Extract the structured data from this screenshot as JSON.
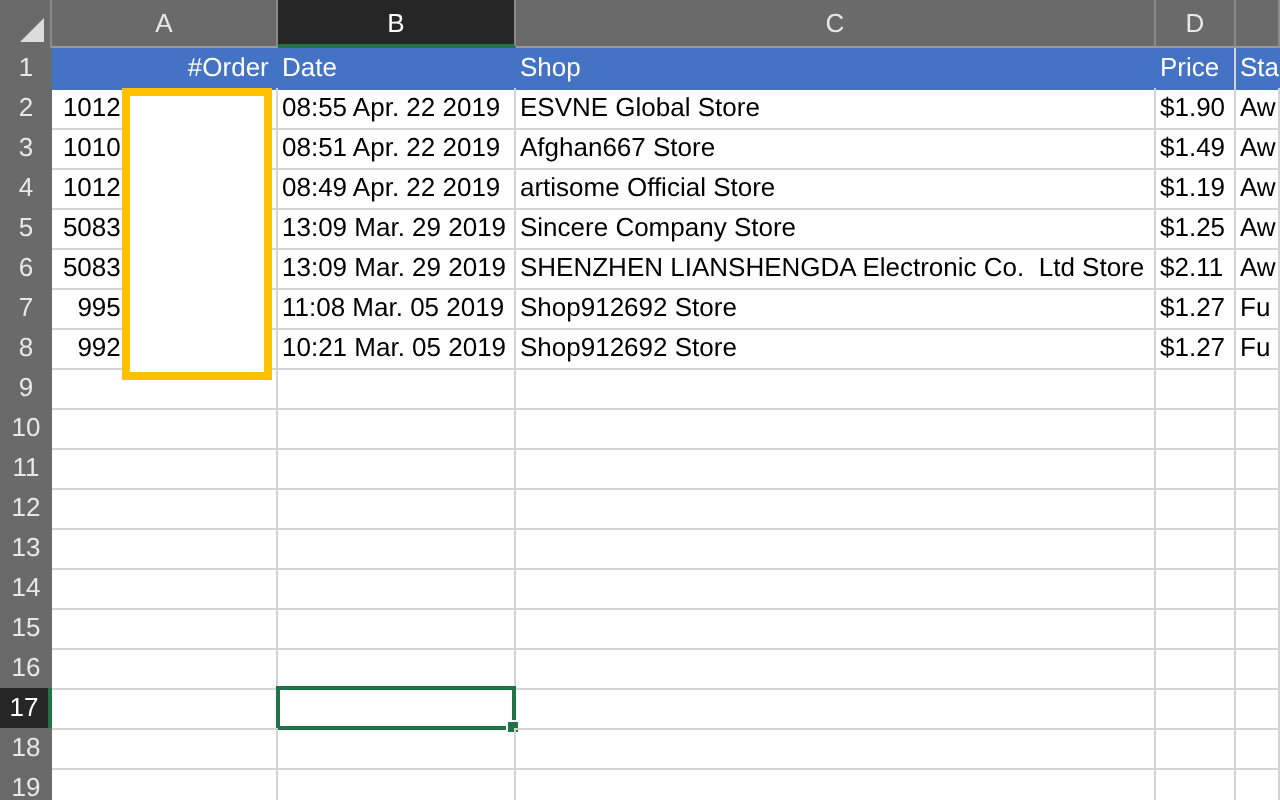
{
  "columns": [
    {
      "label": "A",
      "selected": false
    },
    {
      "label": "B",
      "selected": true
    },
    {
      "label": "C",
      "selected": false
    },
    {
      "label": "D",
      "selected": false
    },
    {
      "selected": false
    }
  ],
  "rows": [
    {
      "number": "1",
      "selected": false,
      "kind": "header",
      "cells": [
        "#Order",
        "Date",
        "Shop",
        "Price",
        "Sta"
      ]
    },
    {
      "number": "2",
      "selected": false,
      "kind": "data",
      "cells": [
        "1012",
        "08:55 Apr. 22 2019",
        "ESVNE Global Store",
        "$1.90",
        "Aw"
      ]
    },
    {
      "number": "3",
      "selected": false,
      "kind": "data",
      "cells": [
        "1010",
        "08:51 Apr. 22 2019",
        "Afghan667 Store",
        "$1.49",
        "Aw"
      ]
    },
    {
      "number": "4",
      "selected": false,
      "kind": "data",
      "cells": [
        "1012",
        "08:49 Apr. 22 2019",
        "artisome Official Store",
        "$1.19",
        "Aw"
      ]
    },
    {
      "number": "5",
      "selected": false,
      "kind": "data",
      "cells": [
        "5083",
        "13:09 Mar. 29 2019",
        "Sincere Company Store",
        "$1.25",
        "Aw"
      ]
    },
    {
      "number": "6",
      "selected": false,
      "kind": "data",
      "cells": [
        "5083",
        "13:09 Mar. 29 2019",
        "SHENZHEN LIANSHENGDA Electronic Co.  Ltd Store",
        "$2.11",
        "Aw"
      ]
    },
    {
      "number": "7",
      "selected": false,
      "kind": "data",
      "cells": [
        "995",
        "11:08 Mar. 05 2019",
        "Shop912692 Store",
        "$1.27",
        "Fu"
      ]
    },
    {
      "number": "8",
      "selected": false,
      "kind": "data",
      "cells": [
        "992",
        "10:21 Mar. 05 2019",
        "Shop912692 Store",
        "$1.27",
        "Fu"
      ]
    },
    {
      "number": "9",
      "selected": false,
      "kind": "data",
      "cells": []
    },
    {
      "number": "10",
      "selected": false,
      "kind": "data",
      "cells": []
    },
    {
      "number": "11",
      "selected": false,
      "kind": "data",
      "cells": []
    },
    {
      "number": "12",
      "selected": false,
      "kind": "data",
      "cells": []
    },
    {
      "number": "13",
      "selected": false,
      "kind": "data",
      "cells": []
    },
    {
      "number": "14",
      "selected": false,
      "kind": "data",
      "cells": []
    },
    {
      "number": "15",
      "selected": false,
      "kind": "data",
      "cells": []
    },
    {
      "number": "16",
      "selected": false,
      "kind": "data",
      "cells": []
    },
    {
      "number": "17",
      "selected": true,
      "kind": "data",
      "cells": []
    },
    {
      "number": "18",
      "selected": false,
      "kind": "data",
      "cells": []
    },
    {
      "number": "19",
      "selected": false,
      "kind": "data",
      "cells": []
    }
  ]
}
